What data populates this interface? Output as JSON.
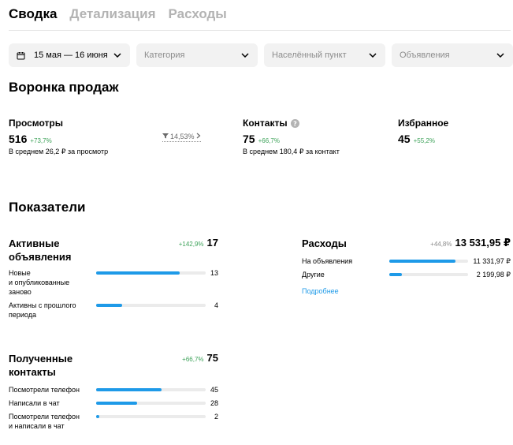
{
  "tabs": [
    {
      "label": "Сводка",
      "active": true
    },
    {
      "label": "Детализация",
      "active": false
    },
    {
      "label": "Расходы",
      "active": false
    }
  ],
  "filters": {
    "date": "15 мая — 16 июня",
    "category": "Категория",
    "city": "Населённый пункт",
    "ads": "Объявления"
  },
  "funnel": {
    "title": "Воронка продаж",
    "views": {
      "title": "Просмотры",
      "value": "516",
      "delta": "+73,7%",
      "sub": "В среднем 26,2 ₽ за просмотр"
    },
    "conversion": "14,53%",
    "contacts": {
      "title": "Контакты",
      "value": "75",
      "delta": "+66,7%",
      "sub": "В среднем 180,4 ₽ за контакт"
    },
    "favorites": {
      "title": "Избранное",
      "value": "45",
      "delta": "+55,2%"
    }
  },
  "metrics": {
    "title": "Показатели",
    "active_ads": {
      "title": "Активные объявления",
      "delta": "+142,9%",
      "total": "17",
      "rows": [
        {
          "label": "Новые\nи опубликованные\nзаново",
          "value": "13",
          "fraction": 0.765
        },
        {
          "label": "Активны с прошлого\nпериода",
          "value": "4",
          "fraction": 0.235
        }
      ]
    },
    "expenses": {
      "title": "Расходы",
      "delta": "+44,8%",
      "total": "13 531,95 ₽",
      "rows": [
        {
          "label": "На объявления",
          "value": "11 331,97 ₽",
          "fraction": 0.837
        },
        {
          "label": "Другие",
          "value": "2 199,98 ₽",
          "fraction": 0.163
        }
      ],
      "link": "Подробнее"
    },
    "contacts": {
      "title": "Полученные контакты",
      "delta": "+66,7%",
      "total": "75",
      "rows": [
        {
          "label": "Посмотрели телефон",
          "value": "45",
          "fraction": 0.6
        },
        {
          "label": "Написали в чат",
          "value": "28",
          "fraction": 0.373
        },
        {
          "label": "Посмотрели телефон\nи написали в чат",
          "value": "2",
          "fraction": 0.027
        }
      ]
    }
  },
  "colors": {
    "accent": "#1e9ae8",
    "positive": "#3fa35b",
    "track": "#ebebeb"
  }
}
